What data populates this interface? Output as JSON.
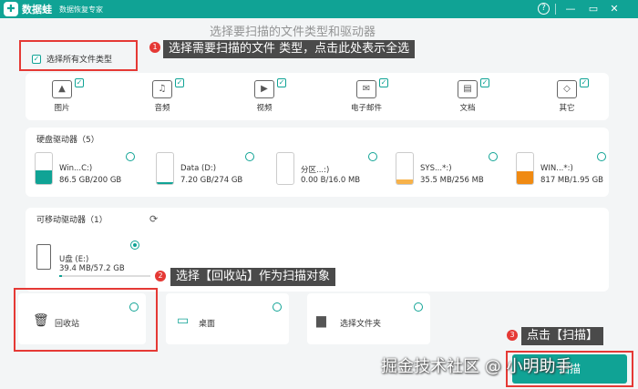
{
  "app": {
    "logo_glyph": "✚",
    "name": "数据蛙",
    "subtitle": "数据恢复专家"
  },
  "titlebar": {
    "help": "?",
    "min": "—",
    "max": "▭",
    "close": "✕"
  },
  "heading": "选择要扫描的文件类型和驱动器",
  "select_all": {
    "label": "选择所有文件类型",
    "checked": true
  },
  "file_types": [
    {
      "label": "图片",
      "icon": "image-icon",
      "glyph": "▲",
      "checked": true
    },
    {
      "label": "音频",
      "icon": "music-icon",
      "glyph": "♫",
      "checked": true
    },
    {
      "label": "视频",
      "icon": "video-icon",
      "glyph": "▶",
      "checked": true
    },
    {
      "label": "电子邮件",
      "icon": "mail-icon",
      "glyph": "✉",
      "checked": true
    },
    {
      "label": "文档",
      "icon": "document-icon",
      "glyph": "▤",
      "checked": true
    },
    {
      "label": "其它",
      "icon": "grid-icon",
      "glyph": "◇",
      "checked": true
    }
  ],
  "hard_drives": {
    "title": "硬盘驱动器（5）",
    "items": [
      {
        "name": "Win...C:)",
        "size": "86.5 GB/200 GB",
        "used": 0.43,
        "color": "#10a395"
      },
      {
        "name": "Data (D:)",
        "size": "7.20 GB/274 GB",
        "used": 0.03,
        "color": "#10a395"
      },
      {
        "name": "分区...:)",
        "size": "0.00  B/16.0 MB",
        "used": 0.0,
        "color": "#f7b24a"
      },
      {
        "name": "SYS...*:)",
        "size": "35.5 MB/256 MB",
        "used": 0.14,
        "color": "#f7b24a"
      },
      {
        "name": "WIN...*:)",
        "size": "817 MB/1.95 GB",
        "used": 0.42,
        "color": "#f08a12"
      }
    ]
  },
  "removable": {
    "title": "可移动驱动器（1）",
    "refresh_icon": "⟳",
    "items": [
      {
        "name": "U盘 (E:)",
        "size": "39.4 MB/57.2 GB",
        "used": 0.01,
        "selected": true
      }
    ]
  },
  "locations": [
    {
      "label": "回收站",
      "icon": "recycle-bin-icon",
      "glyph": "🗑"
    },
    {
      "label": "桌面",
      "icon": "desktop-icon",
      "glyph": "▭"
    },
    {
      "label": "选择文件夹",
      "icon": "folder-icon",
      "glyph": "▆"
    }
  ],
  "annotations": [
    {
      "num": "1",
      "text": "选择需要扫描的文件 类型，点击此处表示全选"
    },
    {
      "num": "2",
      "text": "选择【回收站】作为扫描对象"
    },
    {
      "num": "3",
      "text": "点击【扫描】"
    }
  ],
  "scan_button": "扫描",
  "watermark": "掘金技术社区 @ 小明助手",
  "colors": {
    "accent": "#10a395",
    "annotation_red": "#e53935"
  }
}
